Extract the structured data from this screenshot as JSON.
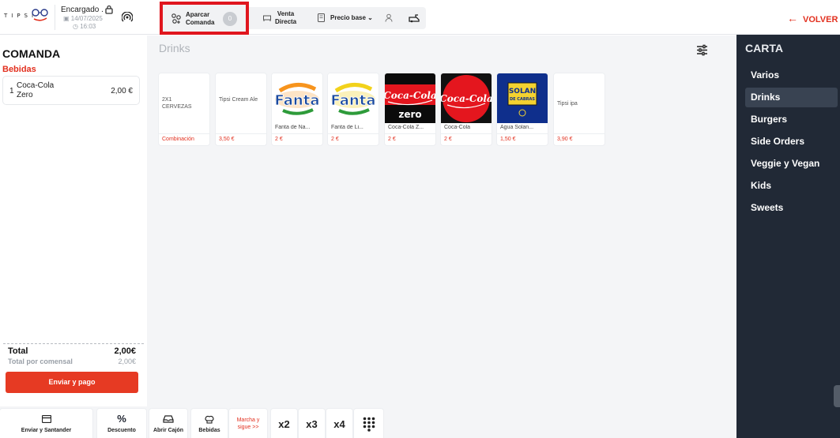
{
  "header": {
    "logo_text": "TIPSI",
    "order_name": "Encargado .",
    "date": "14/07/2025",
    "time": "16:03",
    "park_order_label_1": "Aparcar",
    "park_order_label_2": "Comanda",
    "park_order_count": "0",
    "direct_sale_label_1": "Venta",
    "direct_sale_label_2": "Directa",
    "price_base_label": "Precio base",
    "back_label": "VOLVER"
  },
  "order": {
    "title": "COMANDA",
    "category": "Bebidas",
    "items": [
      {
        "qty": "1",
        "name": "Coca-Cola Zero",
        "price": "2,00 €"
      }
    ],
    "total_label": "Total",
    "total_value": "2,00€",
    "per_diner_label": "Total por comensal",
    "per_diner_value": "2,00€",
    "pay_button": "Enviar y pago"
  },
  "products": {
    "section_title": "Drinks",
    "items": [
      {
        "name": "2X1 CERVEZAS",
        "price": "Combinación",
        "image": "none"
      },
      {
        "name": "Tipsi Cream Ale",
        "price": "3,50 €",
        "image": "none"
      },
      {
        "name": "Fanta de Na...",
        "price": "2 €",
        "image": "fanta-orange"
      },
      {
        "name": "Fanta de Li...",
        "price": "2 €",
        "image": "fanta-lemon"
      },
      {
        "name": "Coca-Cola Z...",
        "price": "2 €",
        "image": "coca-cola-zero"
      },
      {
        "name": "Coca-Cola",
        "price": "2 €",
        "image": "coca-cola"
      },
      {
        "name": "Agua Solan...",
        "price": "1,50 €",
        "image": "solan-de-cabras"
      },
      {
        "name": "Tipsi ipa",
        "price": "3,90 €",
        "image": "none"
      }
    ]
  },
  "images": {
    "fanta": "Fanta",
    "coca_cola": "Coca-Cola",
    "zero": "zero",
    "solan_1": "SOLAN",
    "solan_2": "DE CABRAS"
  },
  "carta": {
    "title": "CARTA",
    "items": [
      "Varios",
      "Drinks",
      "Burgers",
      "Side Orders",
      "Veggie y Vegan",
      "Kids",
      "Sweets"
    ],
    "active": "Drinks"
  },
  "bottom": {
    "send_santander": "Enviar y Santander",
    "discount": "Descuento",
    "open_drawer": "Abrir Cajón",
    "drinks": "Bebidas",
    "marcha_1": "Marcha y",
    "marcha_2": "sigue >>",
    "x2": "x2",
    "x3": "x3",
    "x4": "x4"
  },
  "colors": {
    "accent": "#e2301f",
    "carta_bg": "#212936",
    "highlight_border": "#e0161e"
  }
}
